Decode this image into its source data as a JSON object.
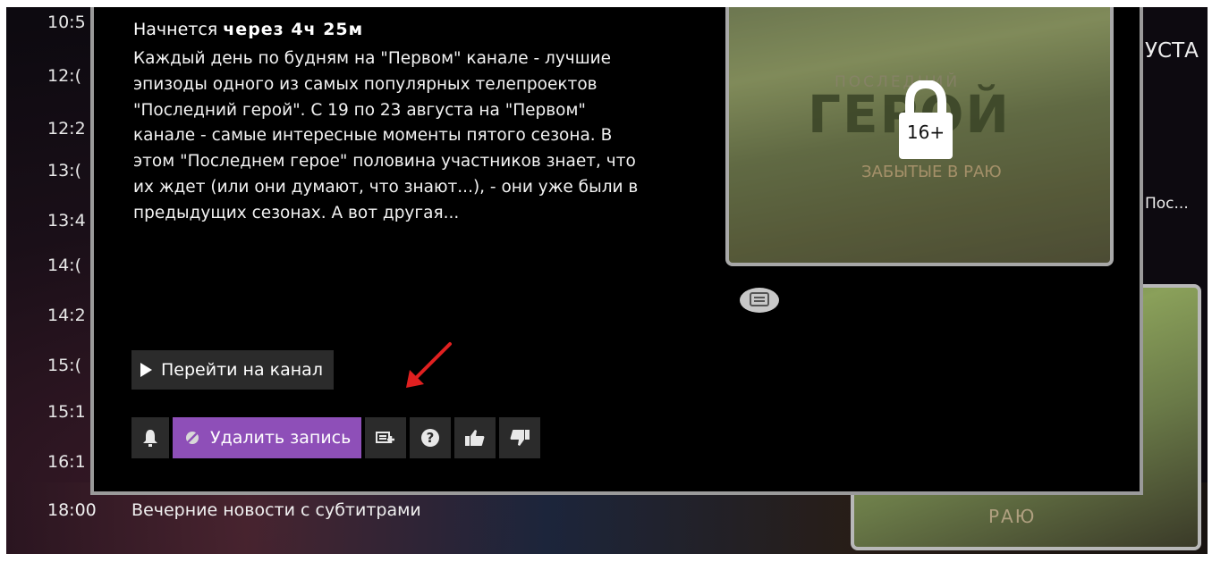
{
  "schedule": {
    "times": [
      "10:5",
      "12:(",
      "12:2",
      "13:(",
      "13:4",
      "14:(",
      "14:2",
      "15:(",
      "15:1",
      "16:1"
    ],
    "bottom_row": {
      "time": "18:00",
      "title": "Вечерние новости с субтитрами"
    }
  },
  "right_panel": {
    "header_partial": "УСТА",
    "item_partial": "Пос..."
  },
  "popup": {
    "start_prefix": "Начнется",
    "start_time": "через 4ч 25м",
    "description": "Каждый день по будням на \"Первом\" канале - лучшие эпизоды одного из самых популярных телепроектов \"Последний герой\". С 19 по 23 августа на \"Первом\" канале - самые интересные моменты пятого сезона. В этом \"Последнем герое\" половина участников знает, что их ждет (или они думают, что знают...), - они уже были в предыдущих сезонах. А вот другая...",
    "goto_channel_label": "Перейти на канал",
    "delete_record_label": "Удалить запись",
    "age_rating": "16+",
    "poster": {
      "title_top": "ПОСЛЕДНИЙ",
      "title_main": "ГЕРОЙ",
      "title_sub": "ЗАБЫТЫЕ В РАЮ"
    },
    "background_poster_label": "РАЮ"
  },
  "icons": {
    "reminder": "bell-icon",
    "delete": "no-record-icon",
    "record_series": "record-series-icon",
    "help": "question-icon",
    "like": "thumbs-up-icon",
    "dislike": "thumbs-down-icon",
    "subtitles": "subtitles-icon",
    "lock": "lock-icon"
  },
  "colors": {
    "accent_purple": "#8e4fb8",
    "button_bg": "#2b2b2b",
    "annotation_arrow": "#e02020"
  }
}
